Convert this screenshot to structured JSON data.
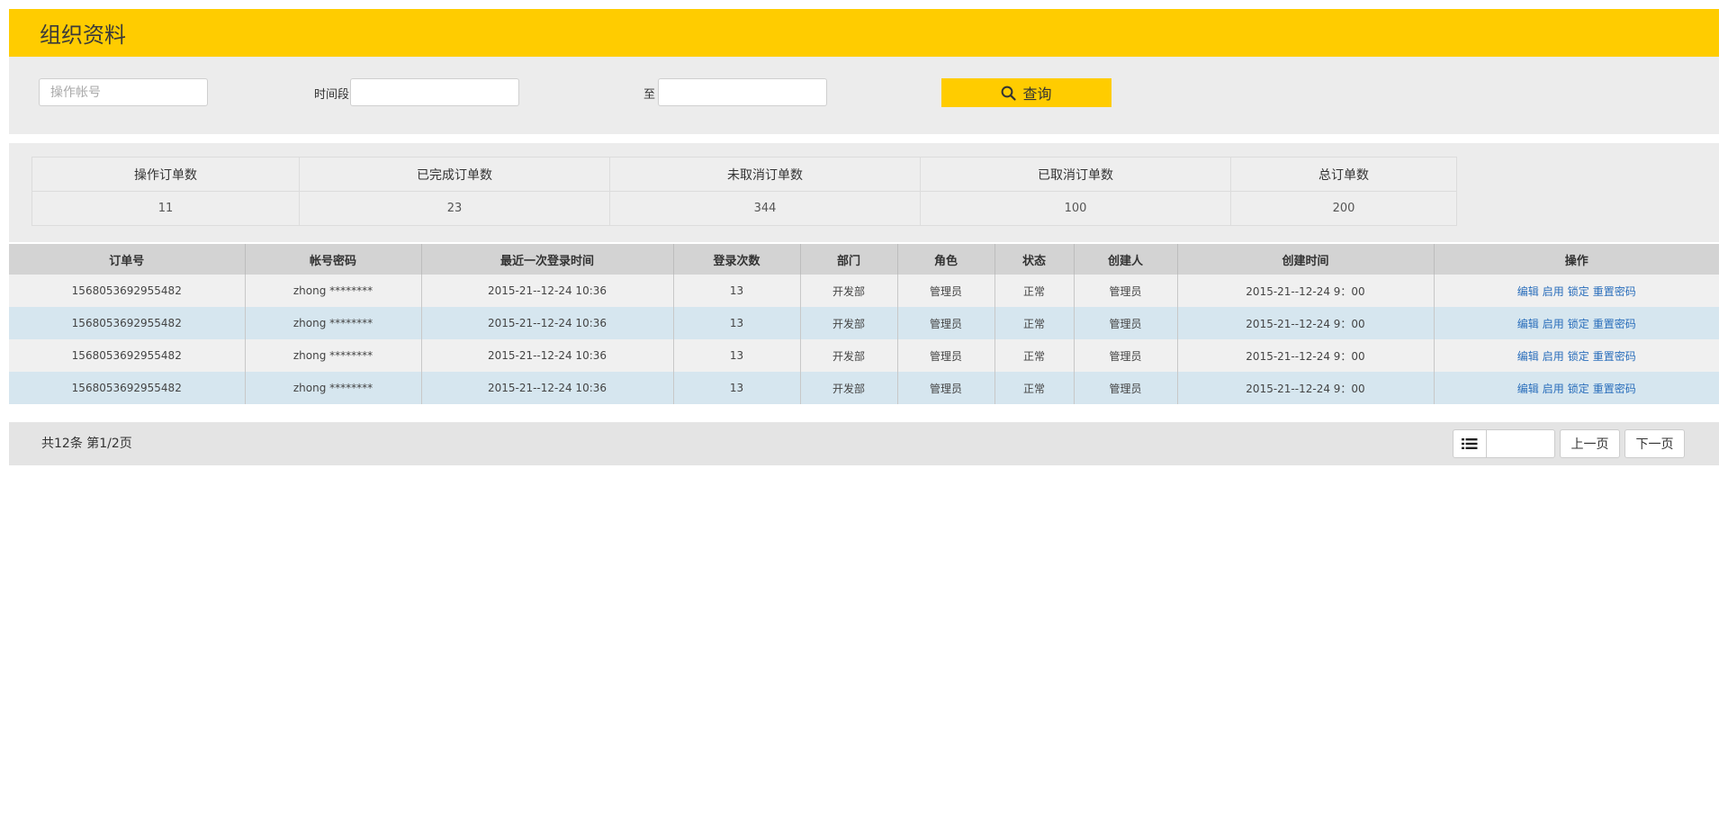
{
  "page": {
    "title": "组织资料"
  },
  "filters": {
    "account_placeholder": "操作帐号",
    "time_label": "时间段",
    "to_label": "至",
    "query_label": "查询"
  },
  "stats": {
    "headers": [
      "操作订单数",
      "已完成订单数",
      "未取消订单数",
      "已取消订单数",
      "总订单数"
    ],
    "values": [
      "11",
      "23",
      "344",
      "100",
      "200"
    ]
  },
  "table": {
    "headers": [
      "订单号",
      "帐号密码",
      "最近一次登录时间",
      "登录次数",
      "部门",
      "角色",
      "状态",
      "创建人",
      "创建时间",
      "操作"
    ],
    "rows": [
      [
        "1568053692955482",
        "zhong  ********",
        "2015-21--12-24 10:36",
        "13",
        "开发部",
        "管理员",
        "正常",
        "管理员",
        "2015-21--12-24 9：00"
      ],
      [
        "1568053692955482",
        "zhong  ********",
        "2015-21--12-24 10:36",
        "13",
        "开发部",
        "管理员",
        "正常",
        "管理员",
        "2015-21--12-24 9：00"
      ],
      [
        "1568053692955482",
        "zhong  ********",
        "2015-21--12-24 10:36",
        "13",
        "开发部",
        "管理员",
        "正常",
        "管理员",
        "2015-21--12-24 9：00"
      ],
      [
        "1568053692955482",
        "zhong  ********",
        "2015-21--12-24 10:36",
        "13",
        "开发部",
        "管理员",
        "正常",
        "管理员",
        "2015-21--12-24 9：00"
      ]
    ],
    "actions": [
      "编辑",
      "启用",
      "锁定",
      "重置密码"
    ]
  },
  "pagination": {
    "summary": "共12条 第1/2页",
    "prev_label": "上一页",
    "next_label": "下一页",
    "page_input_value": ""
  },
  "colors": {
    "accent": "#ffcc00",
    "link": "#2a6ebb",
    "row_alt": "#d6e6ef"
  },
  "icons": {
    "query": "search-icon",
    "page_list": "list-icon"
  }
}
